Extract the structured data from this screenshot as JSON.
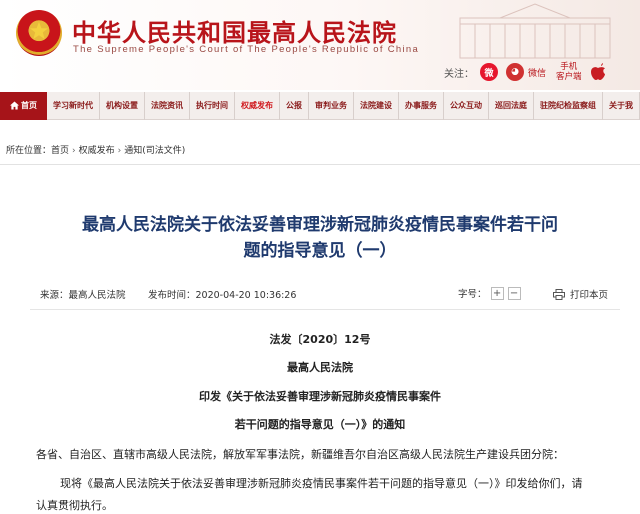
{
  "header": {
    "title": "中华人民共和国最高人民法院",
    "subtitle": "The Supreme People's Court of The People's Republic of China",
    "follow_label": "关注：",
    "weibo_label": "",
    "wechat_label": "微信",
    "mobile_label_1": "手机",
    "mobile_label_2": "客户端"
  },
  "nav": {
    "home": "首页",
    "items": [
      "学习新时代",
      "机构设置",
      "法院资讯",
      "执行时间",
      "权威发布",
      "公报",
      "审判业务",
      "法院建设",
      "办事服务",
      "公众互动",
      "巡回法庭",
      "驻院纪检监察组",
      "关于我"
    ],
    "active_index": 4
  },
  "breadcrumb": {
    "prefix": "所在位置：",
    "items": [
      "首页",
      "权威发布",
      "通知(司法文件)"
    ],
    "separator": "›"
  },
  "article": {
    "title_line1": "最高人民法院关于依法妥善审理涉新冠肺炎疫情民事案件若干问",
    "title_line2": "题的指导意见（一）",
    "source": "来源：最高人民法院",
    "publish_time": "发布时间：2020-04-20 10:36:26",
    "font_size_label": "字号：",
    "print_label": "打印本页",
    "doc_number": "法发〔2020〕12号",
    "court": "最高人民法院",
    "issue_line1": "印发《关于依法妥善审理涉新冠肺炎疫情民事案件",
    "issue_line2": "若干问题的指导意见（一）》的通知",
    "addressee": "各省、自治区、直辖市高级人民法院，解放军军事法院，新疆维吾尔自治区高级人民法院生产建设兵团分院：",
    "body_line1": "现将《最高人民法院关于依法妥善审理涉新冠肺炎疫情民事案件若干问题的指导意见（一）》印发给你们，请",
    "body_line2": "认真贯彻执行。"
  },
  "colors": {
    "brand_red": "#b8141a",
    "title_blue": "#1f3a6e",
    "nav_bg": "#f3eeec"
  }
}
